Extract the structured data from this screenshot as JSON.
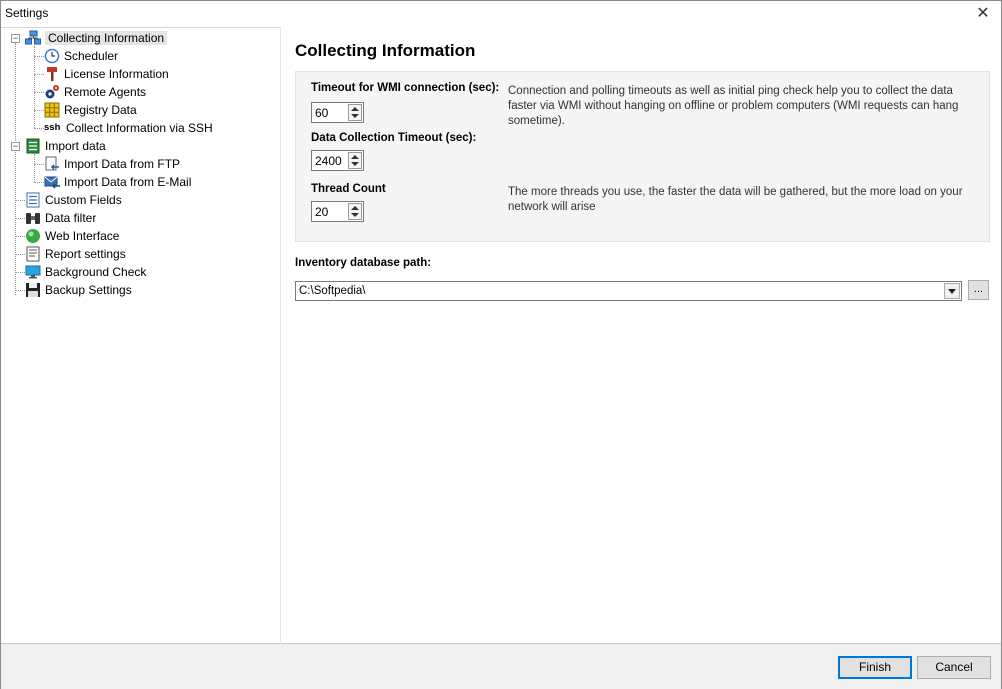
{
  "window": {
    "title": "Settings"
  },
  "tree": {
    "items": [
      {
        "label": "Collecting Information"
      },
      {
        "label": "Scheduler"
      },
      {
        "label": "License Information"
      },
      {
        "label": "Remote Agents"
      },
      {
        "label": "Registry Data"
      },
      {
        "label": "Collect Information via SSH",
        "icon_text": "ssh"
      },
      {
        "label": "Import data"
      },
      {
        "label": "Import Data from FTP"
      },
      {
        "label": "Import Data from E-Mail"
      },
      {
        "label": "Custom Fields"
      },
      {
        "label": "Data filter"
      },
      {
        "label": "Web Interface"
      },
      {
        "label": "Report settings"
      },
      {
        "label": "Background Check"
      },
      {
        "label": "Backup Settings"
      }
    ]
  },
  "main": {
    "heading": "Collecting Information",
    "fields": {
      "wmi_timeout": {
        "label": "Timeout for WMI connection (sec):",
        "value": "60"
      },
      "collection_timeout": {
        "label": "Data Collection Timeout (sec):",
        "value": "2400"
      },
      "thread_count": {
        "label": "Thread Count",
        "value": "20"
      }
    },
    "desc_timeouts": "Connection and polling timeouts as well as initial ping check help you to collect the data faster via WMI without hanging on offline or problem computers (WMI requests can hang sometime).",
    "desc_threads": "The more threads you use, the faster the data will be gathered, but the more load on your network will arise",
    "db_path": {
      "label": "Inventory database path:",
      "value": "C:\\Softpedia\\",
      "browse": "..."
    }
  },
  "footer": {
    "finish": "Finish",
    "cancel": "Cancel"
  }
}
